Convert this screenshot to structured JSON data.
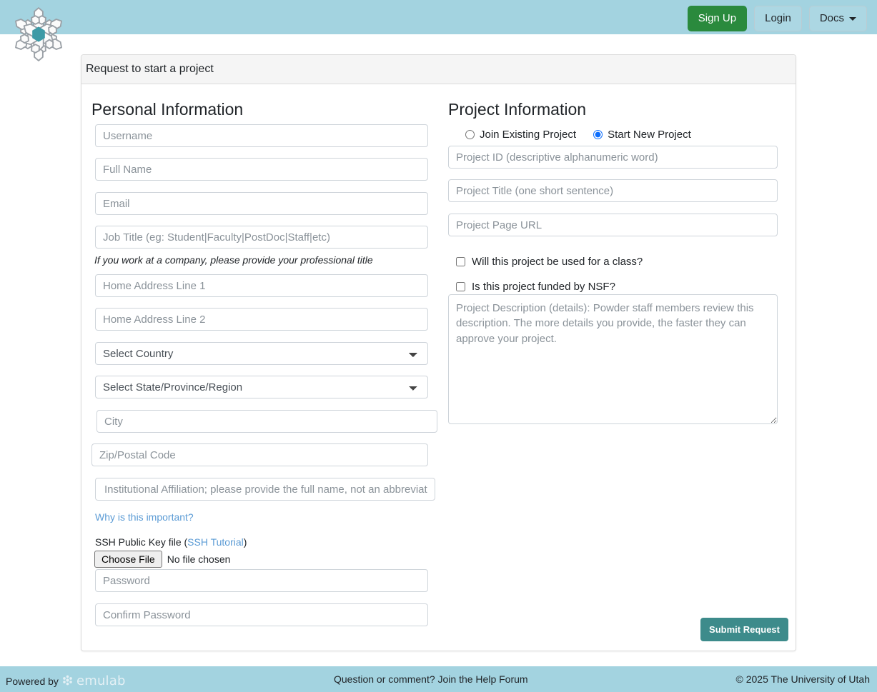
{
  "navbar": {
    "logo_icon": "snowflake-logo",
    "signup_label": "Sign Up",
    "login_label": "Login",
    "docs_label": "Docs",
    "docs_caret_icon": "chevron-down-icon",
    "background_color": "#a3d3e0",
    "signup_color": "#2a8a3d"
  },
  "card": {
    "header_title": "Request to start a project"
  },
  "personal": {
    "section_title": "Personal Information",
    "username_placeholder": "Username",
    "fullname_placeholder": "Full Name",
    "email_placeholder": "Email",
    "jobtitle_placeholder": "Job Title (eg: Student|Faculty|PostDoc|Staff|etc)",
    "jobtitle_helper": "If you work at a company, please provide your professional title",
    "address1_placeholder": "Home Address Line 1",
    "address2_placeholder": "Home Address Line 2",
    "country_selected": "Select Country",
    "state_selected": "Select State/Province/Region",
    "city_placeholder": "City",
    "zip_placeholder": "Zip/Postal Code",
    "affiliation_placeholder": "Institutional Affiliation; please provide the full name, not an abbreviation",
    "affiliation_link": "Why is this important?",
    "ssh_label_prefix": "SSH Public Key file (",
    "ssh_tutorial_link": "SSH Tutorial",
    "ssh_label_suffix": ")",
    "choose_file_label": "Choose File",
    "no_file_label": "No file chosen",
    "password_placeholder": "Password",
    "confirm_password_placeholder": "Confirm Password"
  },
  "project": {
    "section_title": "Project Information",
    "radio_join_label": "Join Existing Project",
    "radio_new_label": "Start New Project",
    "selected_radio": "Start New Project",
    "project_id_placeholder": "Project ID (descriptive alphanumeric word)",
    "project_title_placeholder": "Project Title (one short sentence)",
    "project_url_placeholder": "Project Page URL",
    "class_checkbox_label": "Will this project be used for a class?",
    "nsf_checkbox_label": "Is this project funded by NSF?",
    "description_placeholder": "Project Description (details): Powder staff members review this description. The more details you provide, the faster they can approve your project.",
    "submit_label": "Submit Request",
    "submit_color": "#3d8b8b"
  },
  "footer": {
    "powered_by": "Powered by",
    "emulab_wordmark": "emulab",
    "help_text": "Question or comment? Join the Help Forum",
    "copyright": "© 2025 The University of Utah",
    "background_color": "#a3d3e0"
  }
}
